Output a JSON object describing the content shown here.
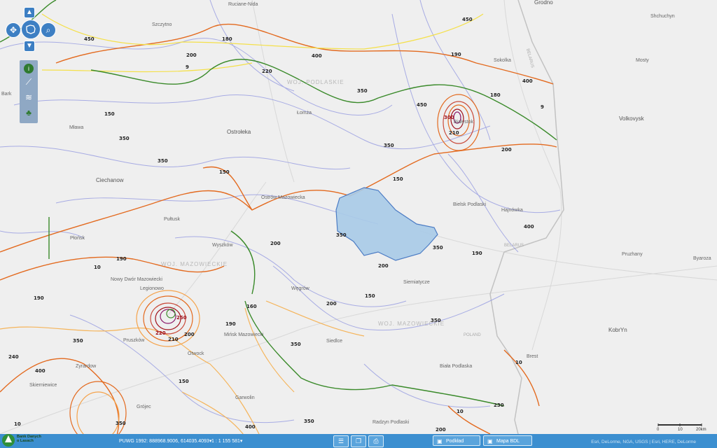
{
  "places": [
    {
      "name": "Grodno"
    },
    {
      "name": "Shchuchyn"
    },
    {
      "name": "Mosty"
    },
    {
      "name": "Volkovysk"
    },
    {
      "name": "Sokolka"
    },
    {
      "name": "Białystok"
    },
    {
      "name": "Bielsk Podlaski"
    },
    {
      "name": "Hajnówka"
    },
    {
      "name": "Pruzhany"
    },
    {
      "name": "Byaroza"
    },
    {
      "name": "KobrYn"
    },
    {
      "name": "Brest"
    },
    {
      "name": "Biała Podlaska"
    },
    {
      "name": "Siedlce"
    },
    {
      "name": "Węgrów"
    },
    {
      "name": "Siemiatycze"
    },
    {
      "name": "Radzyn Podlaski"
    },
    {
      "name": "Garwolin"
    },
    {
      "name": "Mińsk Mazowiecki"
    },
    {
      "name": "Otwock"
    },
    {
      "name": "Pruszków"
    },
    {
      "name": "Zyrardow"
    },
    {
      "name": "Skierniewice"
    },
    {
      "name": "Grójec"
    },
    {
      "name": "Legionowo"
    },
    {
      "name": "Nowy Dwór Mazowiecki"
    },
    {
      "name": "Płońsk"
    },
    {
      "name": "Pułtusk"
    },
    {
      "name": "Wyszków"
    },
    {
      "name": "Ostrów Mazowiecka"
    },
    {
      "name": "Ciechanow"
    },
    {
      "name": "Mława"
    },
    {
      "name": "Ostrołeka"
    },
    {
      "name": "Łomża"
    },
    {
      "name": "Szczytno"
    },
    {
      "name": "Ruciane-Nida"
    },
    {
      "name": "Bark"
    }
  ],
  "regions": [
    {
      "name": "WOJ. PODLASKIE"
    },
    {
      "name": "WOJ. MAZOWIECKIE"
    },
    {
      "name": "WOJ. MAZOWIECKIE"
    }
  ],
  "borders": [
    {
      "name": "BELARUS"
    },
    {
      "name": "POLAND"
    },
    {
      "name": "BELARUS"
    }
  ],
  "isolines": [
    "450",
    "400",
    "350",
    "300",
    "250",
    "240",
    "230",
    "220",
    "210",
    "200",
    "190",
    "180",
    "160",
    "150",
    "10",
    "9"
  ],
  "toolbar": {
    "coordinates": "PUWG 1992: 888968.9006, 614035.4093▾",
    "scale": "1 : 1 155 581▾",
    "podklad": "Podkład",
    "mapa_bdl": "Mapa BDL",
    "attribution": "Esri, DeLorme, NGA, USGS | Esri, HERE, DeLorme",
    "logo_text": "Bank Danych o Lasach"
  },
  "scalebar": {
    "labels": [
      "0",
      "10",
      "20km"
    ]
  },
  "colors": {
    "bar": "#3c8fd0",
    "selection": "#a9cbe8",
    "isoline_red": "#a0101a"
  }
}
